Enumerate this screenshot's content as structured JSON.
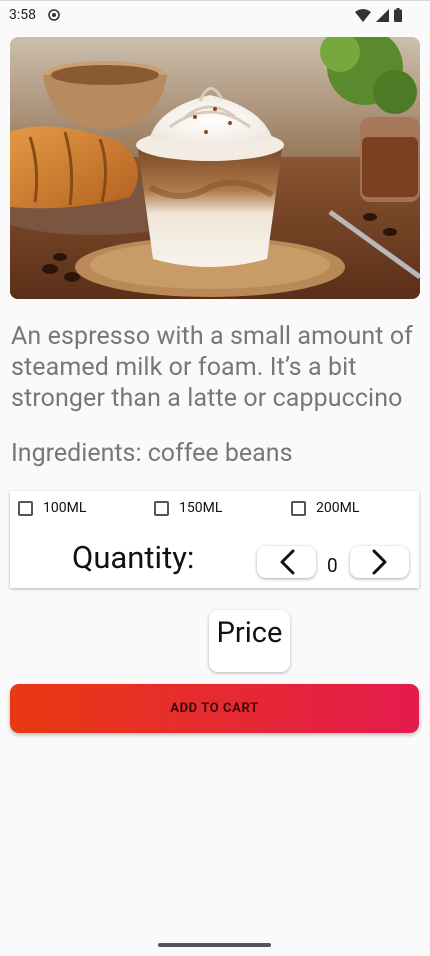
{
  "status_bar": {
    "time": "3:58",
    "icons": [
      "notification-icon",
      "wifi-icon",
      "signal-icon",
      "battery-icon"
    ]
  },
  "product": {
    "image_alt": "coffee drink with whipped cream and croissant",
    "description": "An espresso with a small amount of steamed milk or foam. It’s a bit stronger than a latte or cappuccino",
    "ingredients": "Ingredients: coffee beans"
  },
  "options": {
    "sizes": [
      {
        "label": "100ML",
        "checked": false
      },
      {
        "label": "150ML",
        "checked": false
      },
      {
        "label": "200ML",
        "checked": false
      }
    ],
    "quantity_label": "Quantity:",
    "quantity_value": "0"
  },
  "price_label": "Price",
  "add_to_cart_label": "ADD TO CART",
  "colors": {
    "gradient_start": "#e83a12",
    "gradient_end": "#e41b4e",
    "text_secondary": "#777777"
  }
}
